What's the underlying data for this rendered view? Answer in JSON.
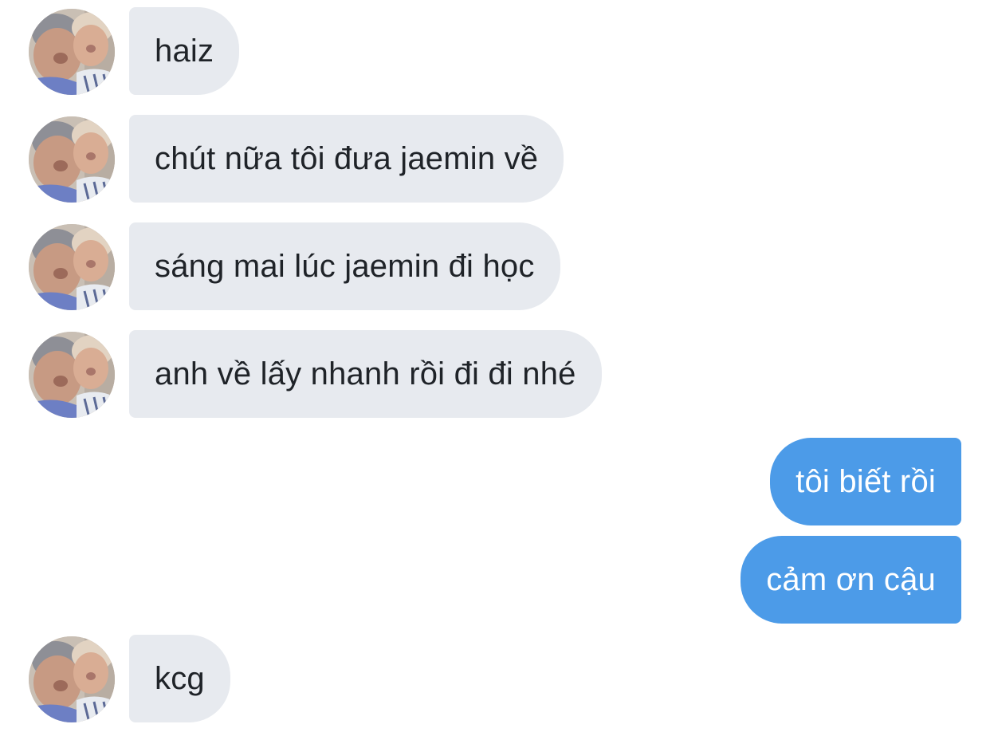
{
  "conversation": {
    "messages": [
      {
        "direction": "incoming",
        "text": "haiz",
        "avatar_icon": "avatar-photo-icon"
      },
      {
        "direction": "incoming",
        "text": "chút nữa tôi đưa jaemin về",
        "avatar_icon": "avatar-photo-icon"
      },
      {
        "direction": "incoming",
        "text": "sáng mai lúc jaemin đi học",
        "avatar_icon": "avatar-photo-icon"
      },
      {
        "direction": "incoming",
        "text": "anh về lấy nhanh rồi đi đi nhé",
        "avatar_icon": "avatar-photo-icon"
      },
      {
        "direction": "outgoing",
        "text": "tôi biết rồi"
      },
      {
        "direction": "outgoing",
        "text": "cảm ơn cậu"
      },
      {
        "direction": "incoming",
        "text": "kcg",
        "avatar_icon": "avatar-photo-icon"
      }
    ]
  },
  "colors": {
    "incoming_bubble": "#e7eaef",
    "outgoing_bubble": "#4c9be8",
    "incoming_text": "#1f2328",
    "outgoing_text": "#ffffff",
    "background": "#ffffff"
  }
}
